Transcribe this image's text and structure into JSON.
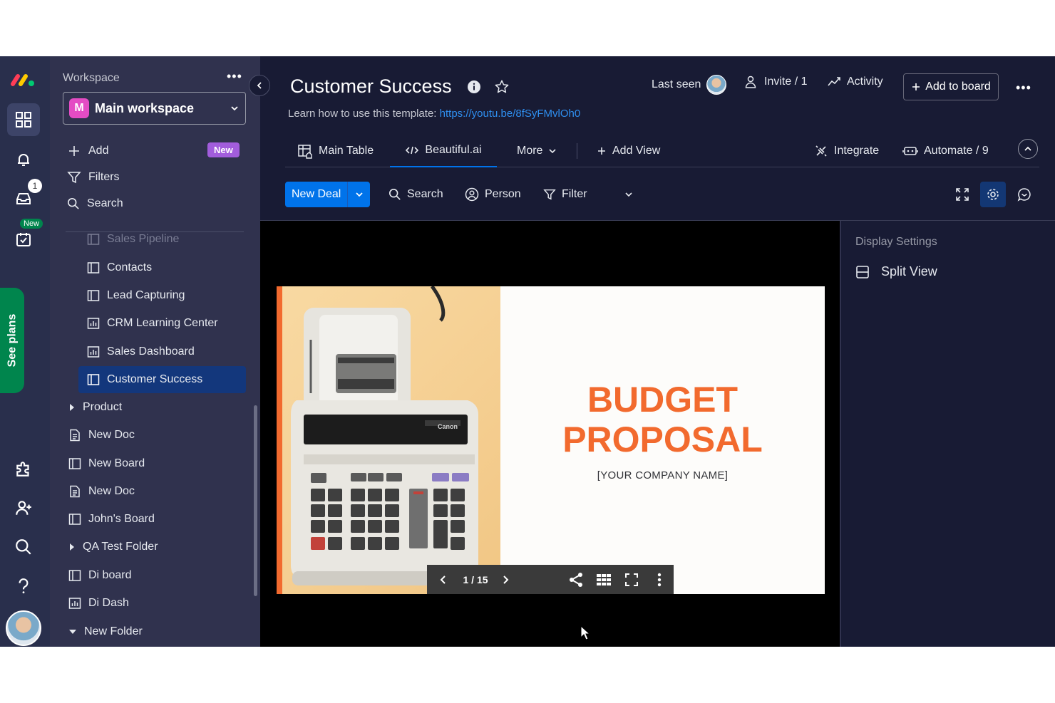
{
  "rail": {
    "badge_count": "1",
    "new_label": "New",
    "see_plans": "See plans"
  },
  "sidebar": {
    "workspace_label": "Workspace",
    "workspace_initial": "M",
    "workspace_name": "Main workspace",
    "add_label": "Add",
    "new_badge": "New",
    "filters_label": "Filters",
    "search_label": "Search",
    "items": [
      {
        "label": "Sales Pipeline"
      },
      {
        "label": "Contacts"
      },
      {
        "label": "Lead Capturing"
      },
      {
        "label": "CRM Learning Center"
      },
      {
        "label": "Sales Dashboard"
      },
      {
        "label": "Customer Success"
      },
      {
        "label": "Product"
      },
      {
        "label": "New Doc"
      },
      {
        "label": "New Board"
      },
      {
        "label": "New Doc"
      },
      {
        "label": "John's Board"
      },
      {
        "label": "QA Test Folder"
      },
      {
        "label": "Di board"
      },
      {
        "label": "Di Dash"
      },
      {
        "label": "New Folder"
      }
    ]
  },
  "header": {
    "title": "Customer Success",
    "last_seen": "Last seen",
    "invite": "Invite / 1",
    "activity": "Activity",
    "add_to_board": "Add to board",
    "subtitle_prefix": "Learn how to use this template:",
    "subtitle_link": "https://youtu.be/8fSyFMvlOh0"
  },
  "views": {
    "tabs": [
      {
        "label": "Main Table"
      },
      {
        "label": "Beautiful.ai"
      },
      {
        "label": "More"
      }
    ],
    "add_view": "Add View",
    "integrate": "Integrate",
    "automate": "Automate / 9"
  },
  "toolbar": {
    "new_deal": "New Deal",
    "search": "Search",
    "person": "Person",
    "filter": "Filter"
  },
  "settings": {
    "title": "Display Settings",
    "split_view": "Split View"
  },
  "slide": {
    "title_line1": "BUDGET",
    "title_line2": "PROPOSAL",
    "company": "[YOUR COMPANY NAME]",
    "page": "1 / 15",
    "brand": "Canon"
  },
  "colors": {
    "rail_bg": "#292f4c",
    "sidebar_bg": "#30324e",
    "main_bg": "#181b34",
    "accent": "#0073ea",
    "slide_accent": "#f26a2e"
  }
}
